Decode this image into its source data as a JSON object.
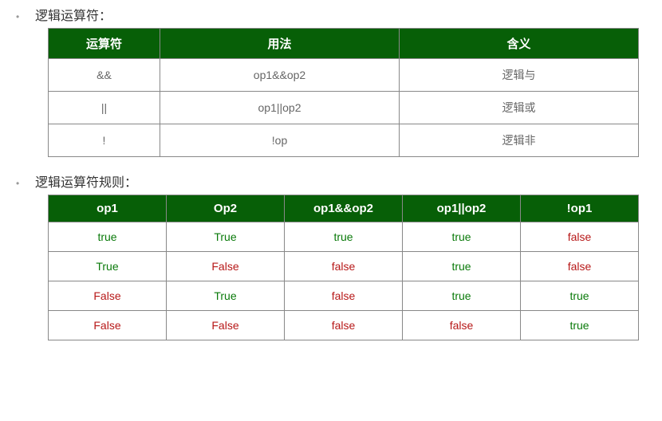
{
  "section1": {
    "label": "逻辑运算符：",
    "headers": [
      "运算符",
      "用法",
      "含义"
    ],
    "rows": [
      {
        "op": "&&",
        "usage": "op1&&op2",
        "meaning": "逻辑与"
      },
      {
        "op": "||",
        "usage": "op1||op2",
        "meaning": "逻辑或"
      },
      {
        "op": "!",
        "usage": "!op",
        "meaning": "逻辑非"
      }
    ]
  },
  "section2": {
    "label": "逻辑运算符规则：",
    "headers": [
      "op1",
      "Op2",
      "op1&&op2",
      "op1||op2",
      "!op1"
    ],
    "rows": [
      {
        "op1": "true",
        "op2": "True",
        "and": "true",
        "or": "true",
        "not": "false"
      },
      {
        "op1": "True",
        "op2": "False",
        "and": "false",
        "or": "true",
        "not": "false"
      },
      {
        "op1": "False",
        "op2": "True",
        "and": "false",
        "or": "true",
        "not": "true"
      },
      {
        "op1": "False",
        "op2": "False",
        "and": "false",
        "or": "false",
        "not": "true"
      }
    ]
  },
  "chart_data": [
    {
      "type": "table",
      "title": "逻辑运算符",
      "columns": [
        "运算符",
        "用法",
        "含义"
      ],
      "rows": [
        [
          "&&",
          "op1&&op2",
          "逻辑与"
        ],
        [
          "||",
          "op1||op2",
          "逻辑或"
        ],
        [
          "!",
          "!op",
          "逻辑非"
        ]
      ]
    },
    {
      "type": "table",
      "title": "逻辑运算符规则",
      "columns": [
        "op1",
        "Op2",
        "op1&&op2",
        "op1||op2",
        "!op1"
      ],
      "rows": [
        [
          "true",
          "True",
          "true",
          "true",
          "false"
        ],
        [
          "True",
          "False",
          "false",
          "true",
          "false"
        ],
        [
          "False",
          "True",
          "false",
          "true",
          "true"
        ],
        [
          "False",
          "False",
          "false",
          "false",
          "true"
        ]
      ]
    }
  ]
}
